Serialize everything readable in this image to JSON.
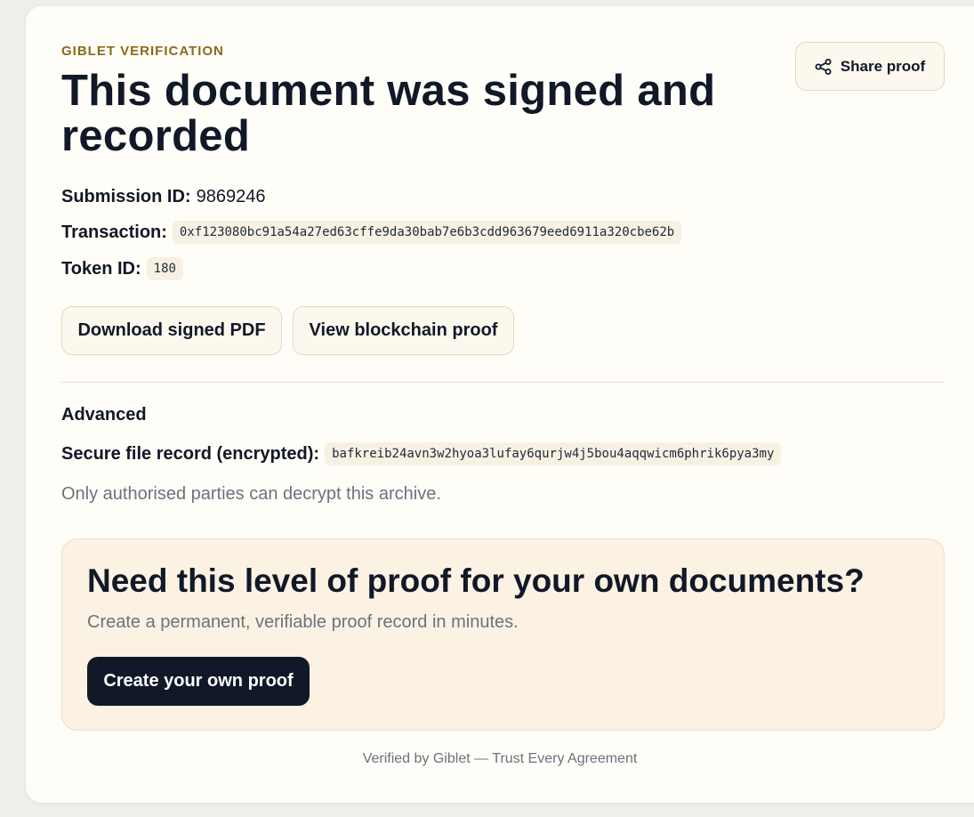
{
  "header": {
    "eyebrow": "GIBLET VERIFICATION",
    "title": "This document was signed and recorded",
    "share_label": "Share proof",
    "share_icon": "share-icon"
  },
  "details": {
    "submission_label": "Submission ID:",
    "submission_value": "9869246",
    "transaction_label": "Transaction:",
    "transaction_value": "0xf123080bc91a54a27ed63cffe9da30bab7e6b3cdd963679eed6911a320cbe62b",
    "token_label": "Token ID:",
    "token_value": "180"
  },
  "actions": {
    "download_label": "Download signed PDF",
    "view_chain_label": "View blockchain proof"
  },
  "advanced": {
    "heading": "Advanced",
    "secure_label": "Secure file record (encrypted):",
    "secure_value": "bafkreib24avn3w2hyoa3lufay6qurjw4j5bou4aqqwicm6phrik6pya3my",
    "note": "Only authorised parties can decrypt this archive."
  },
  "cta": {
    "title": "Need this level of proof for your own documents?",
    "subtitle": "Create a permanent, verifiable proof record in minutes.",
    "button_label": "Create your own proof"
  },
  "footer": {
    "text": "Verified by Giblet — Trust Every Agreement"
  },
  "colors": {
    "accent": "#8a6a1c",
    "dark_button": "#111827",
    "card_bg": "#fffdf7",
    "cta_bg": "#fbf2e3"
  }
}
